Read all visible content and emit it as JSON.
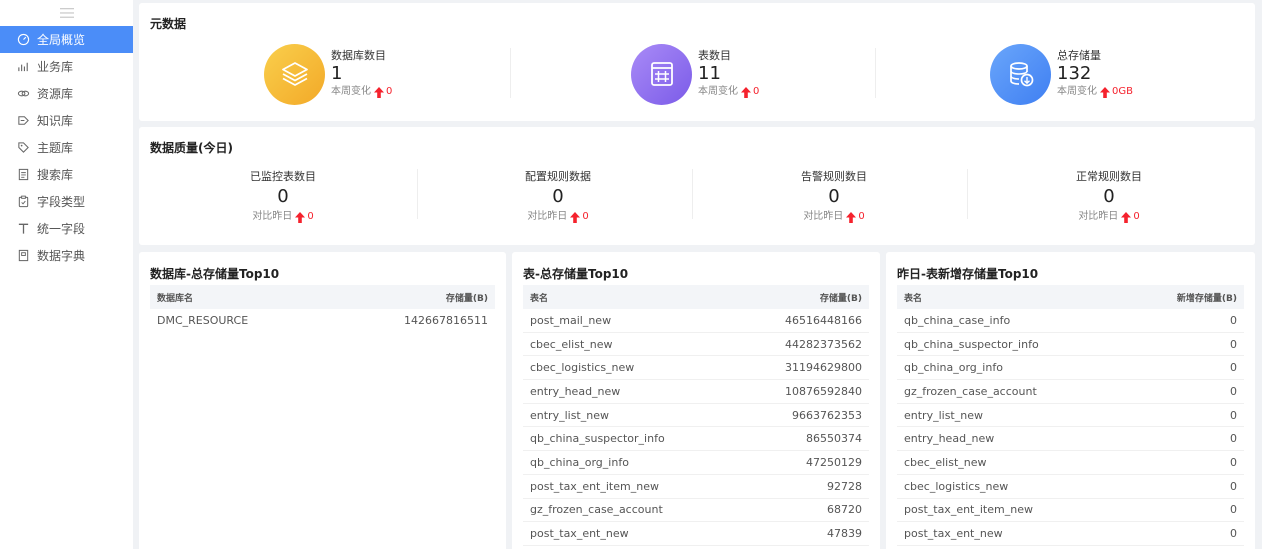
{
  "sidebar": {
    "items": [
      {
        "label": "全局概览",
        "icon": "dashboard-icon",
        "active": true
      },
      {
        "label": "业务库",
        "icon": "chart-icon",
        "active": false
      },
      {
        "label": "资源库",
        "icon": "link-icon",
        "active": false
      },
      {
        "label": "知识库",
        "icon": "knowledge-icon",
        "active": false
      },
      {
        "label": "主题库",
        "icon": "tag-icon",
        "active": false
      },
      {
        "label": "搜索库",
        "icon": "document-icon",
        "active": false
      },
      {
        "label": "字段类型",
        "icon": "clipboard-icon",
        "active": false
      },
      {
        "label": "统一字段",
        "icon": "text-icon",
        "active": false
      },
      {
        "label": "数据字典",
        "icon": "book-icon",
        "active": false
      }
    ]
  },
  "meta": {
    "title": "元数据",
    "items": [
      {
        "label": "数据库数目",
        "value": "1",
        "change_label": "本周变化",
        "change": "0",
        "color": "#f5b82e"
      },
      {
        "label": "表数目",
        "value": "11",
        "change_label": "本周变化",
        "change": "0",
        "color": "#8e6cf0"
      },
      {
        "label": "总存储量",
        "value": "132",
        "change_label": "本周变化",
        "change": "0GB",
        "color": "#4b8df8"
      }
    ]
  },
  "quality": {
    "title": "数据质量(今日)",
    "items": [
      {
        "label": "已监控表数目",
        "value": "0",
        "change_label": "对比昨日",
        "change": "0"
      },
      {
        "label": "配置规则数据",
        "value": "0",
        "change_label": "对比昨日",
        "change": "0"
      },
      {
        "label": "告警规则数目",
        "value": "0",
        "change_label": "对比昨日",
        "change": "0"
      },
      {
        "label": "正常规则数目",
        "value": "0",
        "change_label": "对比昨日",
        "change": "0"
      }
    ]
  },
  "db_top": {
    "title": "数据库-总存储量Top10",
    "col1": "数据库名",
    "col2": "存储量(B)",
    "rows": [
      [
        "DMC_RESOURCE",
        "142667816511"
      ]
    ]
  },
  "table_top": {
    "title": "表-总存储量Top10",
    "col1": "表名",
    "col2": "存储量(B)",
    "rows": [
      [
        "post_mail_new",
        "46516448166"
      ],
      [
        "cbec_elist_new",
        "44282373562"
      ],
      [
        "cbec_logistics_new",
        "31194629800"
      ],
      [
        "entry_head_new",
        "10876592840"
      ],
      [
        "entry_list_new",
        "9663762353"
      ],
      [
        "qb_china_suspector_info",
        "86550374"
      ],
      [
        "qb_china_org_info",
        "47250129"
      ],
      [
        "post_tax_ent_item_new",
        "92728"
      ],
      [
        "gz_frozen_case_account",
        "68720"
      ],
      [
        "post_tax_ent_new",
        "47839"
      ]
    ]
  },
  "new_top": {
    "title": "昨日-表新增存储量Top10",
    "col1": "表名",
    "col2": "新增存储量(B)",
    "rows": [
      [
        "qb_china_case_info",
        "0"
      ],
      [
        "qb_china_suspector_info",
        "0"
      ],
      [
        "qb_china_org_info",
        "0"
      ],
      [
        "gz_frozen_case_account",
        "0"
      ],
      [
        "entry_list_new",
        "0"
      ],
      [
        "entry_head_new",
        "0"
      ],
      [
        "cbec_elist_new",
        "0"
      ],
      [
        "cbec_logistics_new",
        "0"
      ],
      [
        "post_tax_ent_item_new",
        "0"
      ],
      [
        "post_tax_ent_new",
        "0"
      ]
    ]
  }
}
